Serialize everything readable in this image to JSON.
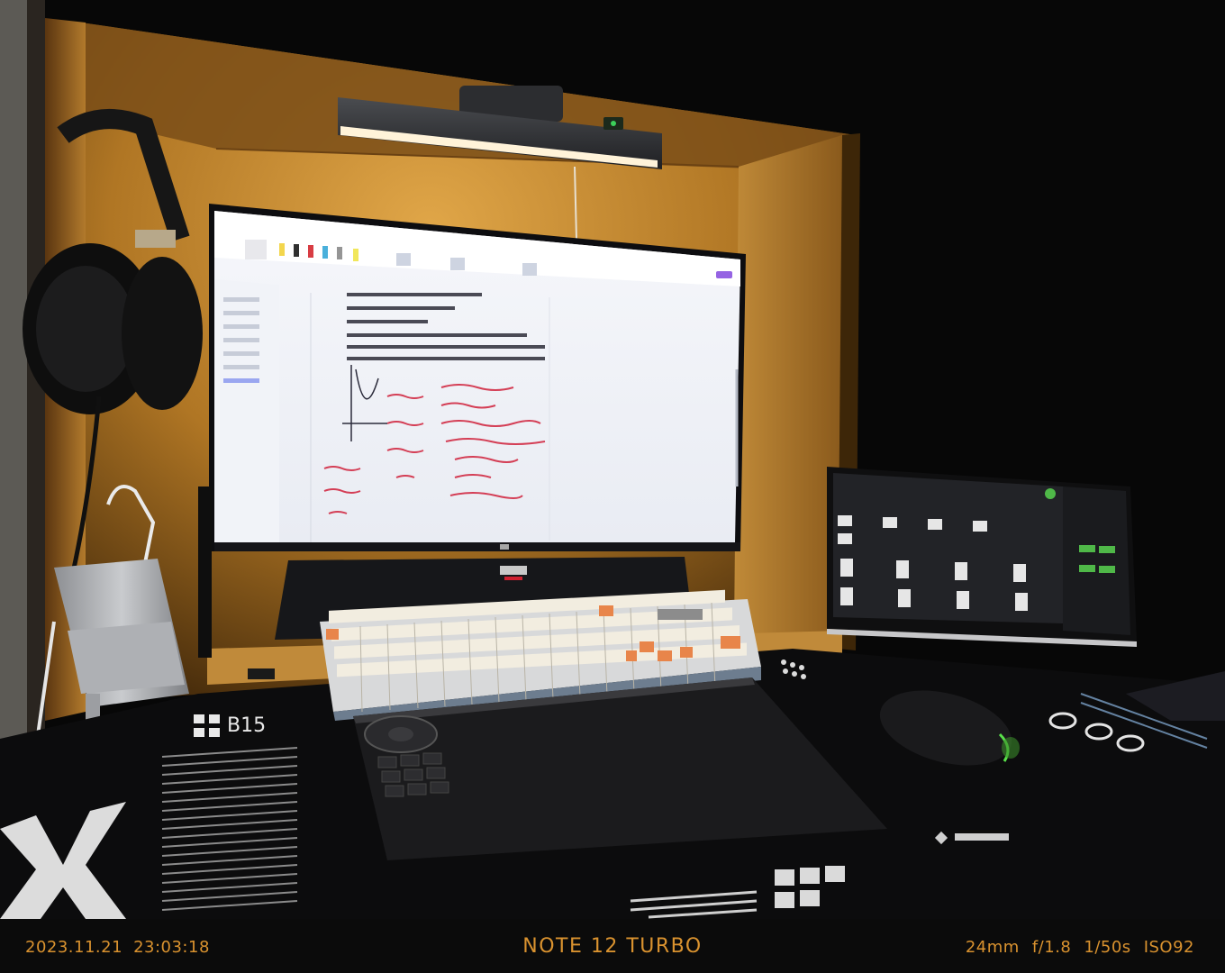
{
  "caption": {
    "date": "2023.11.21",
    "time": "23:03:18",
    "model": "NOTE 12 TURBO",
    "exif": {
      "focal_length": "24mm",
      "aperture": "f/1.8",
      "shutter": "1/50s",
      "iso": "ISO92"
    }
  },
  "scene_text": {
    "desk_mat_label": "B15"
  },
  "colors": {
    "caption_accent": "#d9922f",
    "shelf_wood": "#c8912f",
    "keycap_accent": "#e8854a"
  }
}
